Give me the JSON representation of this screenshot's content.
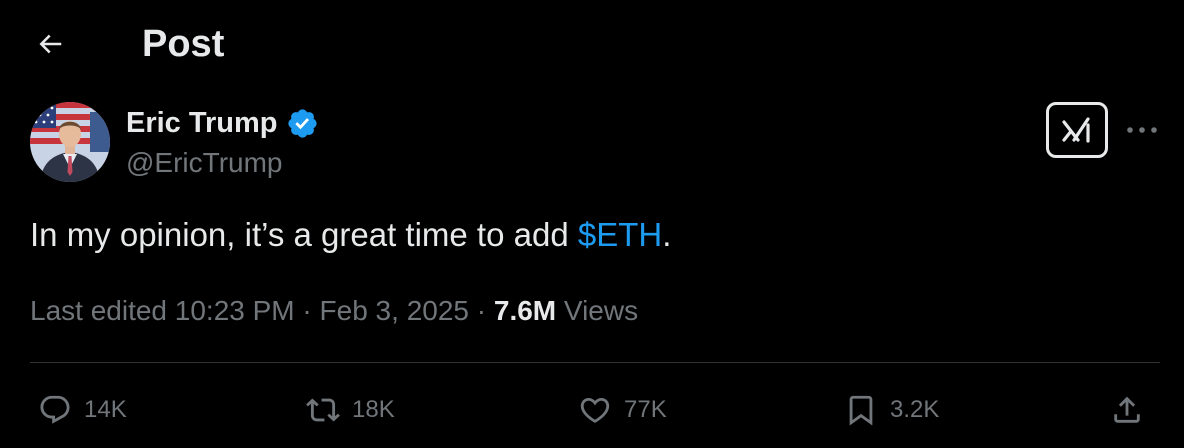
{
  "header": {
    "back_icon": "arrow-left-icon",
    "title": "Post"
  },
  "author": {
    "avatar_icon": "profile-photo",
    "name": "Eric Trump",
    "verified_icon": "verified-badge-icon",
    "handle": "@EricTrump"
  },
  "top_actions": {
    "grok_icon": "grok-icon",
    "more_icon": "more-horizontal-icon"
  },
  "post": {
    "text_before": "In my opinion, it’s a great time to add ",
    "cashtag": "$ETH",
    "text_after": "."
  },
  "meta": {
    "edited_label": "Last edited",
    "time": "10:23 PM",
    "separator": " · ",
    "date": "Feb 3, 2025",
    "views_count": "7.6M",
    "views_label": "Views"
  },
  "actions": {
    "reply": {
      "icon": "reply-icon",
      "count": "14K"
    },
    "repost": {
      "icon": "repost-icon",
      "count": "18K"
    },
    "like": {
      "icon": "heart-icon",
      "count": "77K"
    },
    "bookmark": {
      "icon": "bookmark-icon",
      "count": "3.2K"
    },
    "share": {
      "icon": "share-icon"
    }
  },
  "colors": {
    "background": "#000000",
    "text_primary": "#e7e9ea",
    "text_secondary": "#71767b",
    "accent": "#1d9bf0",
    "divider": "#2f3336"
  }
}
